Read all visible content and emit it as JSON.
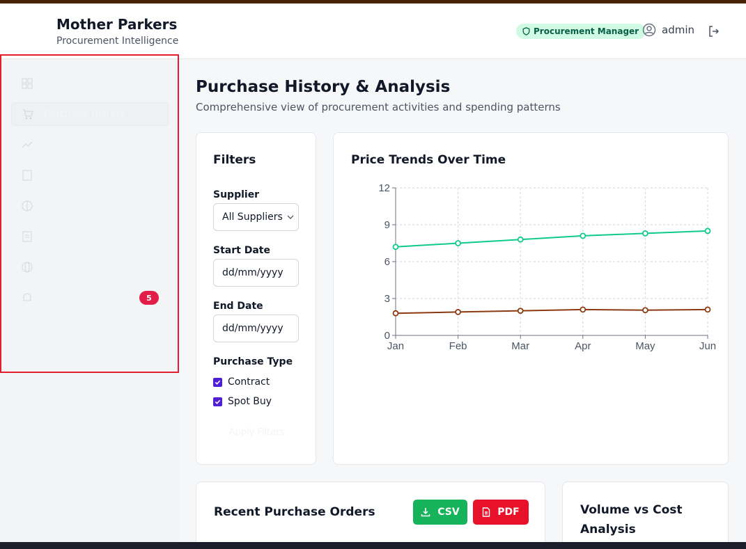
{
  "header": {
    "title": "Mother Parkers",
    "subtitle": "Procurement Intelligence",
    "role_badge": "Procurement Manager",
    "username": "admin"
  },
  "sidebar": {
    "items": [
      {
        "label": "Dashboard",
        "icon": "grid-icon",
        "active": false
      },
      {
        "label": "Purchase History",
        "icon": "cart-icon",
        "active": true
      },
      {
        "label": "Price Intelligence",
        "icon": "trend-icon",
        "active": false
      },
      {
        "label": "Supplier Management",
        "icon": "building-icon",
        "active": false
      },
      {
        "label": "AI Insights",
        "icon": "brain-icon",
        "active": false
      },
      {
        "label": "Contracts",
        "icon": "document-icon",
        "active": false
      },
      {
        "label": "Risk Map",
        "icon": "globe-icon",
        "active": false
      },
      {
        "label": "Alerts",
        "icon": "bell-icon",
        "active": false,
        "badge": "5"
      }
    ]
  },
  "page": {
    "title": "Purchase History & Analysis",
    "subtitle": "Comprehensive view of procurement activities and spending patterns"
  },
  "filters": {
    "title": "Filters",
    "supplier_label": "Supplier",
    "supplier_value": "All Suppliers",
    "start_label": "Start Date",
    "start_placeholder": "dd/mm/yyyy",
    "end_label": "End Date",
    "end_placeholder": "dd/mm/yyyy",
    "type_label": "Purchase Type",
    "types": [
      {
        "label": "Contract",
        "checked": true
      },
      {
        "label": "Spot Buy",
        "checked": true
      }
    ],
    "apply_label": "Apply Filters"
  },
  "trends": {
    "title": "Price Trends Over Time"
  },
  "chart_data": {
    "type": "line",
    "categories": [
      "Jan",
      "Feb",
      "Mar",
      "Apr",
      "May",
      "Jun"
    ],
    "series": [
      {
        "values": [
          7.2,
          7.5,
          7.8,
          8.1,
          8.3,
          8.5
        ],
        "color": "#10c98f"
      },
      {
        "values": [
          1.8,
          1.9,
          2.0,
          2.1,
          2.05,
          2.1
        ],
        "color": "#8b3a0f"
      }
    ],
    "y_ticks": [
      0,
      3,
      6,
      9,
      12
    ],
    "ylim": [
      0,
      12
    ],
    "grid": true
  },
  "orders": {
    "title": "Recent Purchase Orders",
    "csv_label": "CSV",
    "pdf_label": "PDF"
  },
  "volume": {
    "title": "Volume vs Cost Analysis"
  },
  "colors": {
    "brand_bar": "#4a2306",
    "accent_green": "#16b35a",
    "accent_red": "#e7112a",
    "checkbox": "#4f1fd6"
  }
}
